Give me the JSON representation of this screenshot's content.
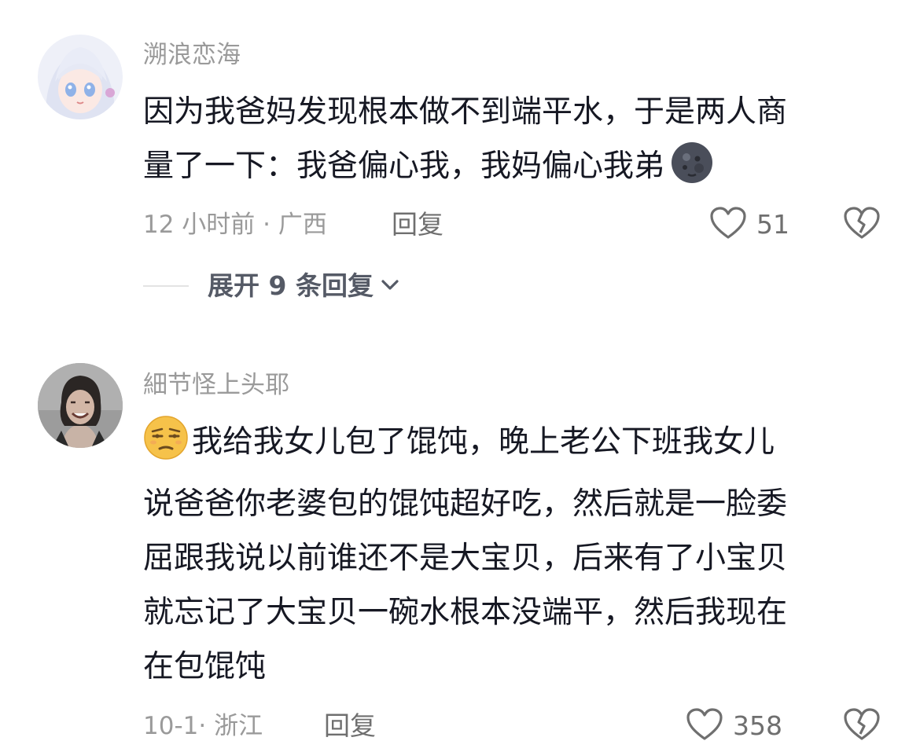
{
  "comments": [
    {
      "username": "溯浪恋海",
      "text_lines": [
        "因为我爸妈发现根本做不到端平水，于是两人商",
        "量了一下：我爸偏心我，我妈偏心我弟"
      ],
      "text_emoji": "new-moon-face-emoji",
      "meta": "12 小时前 · 广西",
      "reply_label": "回复",
      "likes": "51",
      "expand_label": "展开 9 条回复"
    },
    {
      "username": "細节怪上头耶",
      "lead_emoji": "unamused-face-emoji",
      "text_lines": [
        "我给我女儿包了馄饨，晚上老公下班我女儿",
        "说爸爸你老婆包的馄饨超好吃，然后就是一脸委",
        "屈跟我说以前谁还不是大宝贝，后来有了小宝贝",
        "就忘记了大宝贝一碗水根本没端平，然后我现在",
        "在包馄饨"
      ],
      "meta": "10-1· 浙江",
      "reply_label": "回复",
      "likes": "358"
    }
  ],
  "colors": {
    "text": "#161823",
    "muted": "#9a9a9a",
    "action": "#6f6f6f"
  }
}
